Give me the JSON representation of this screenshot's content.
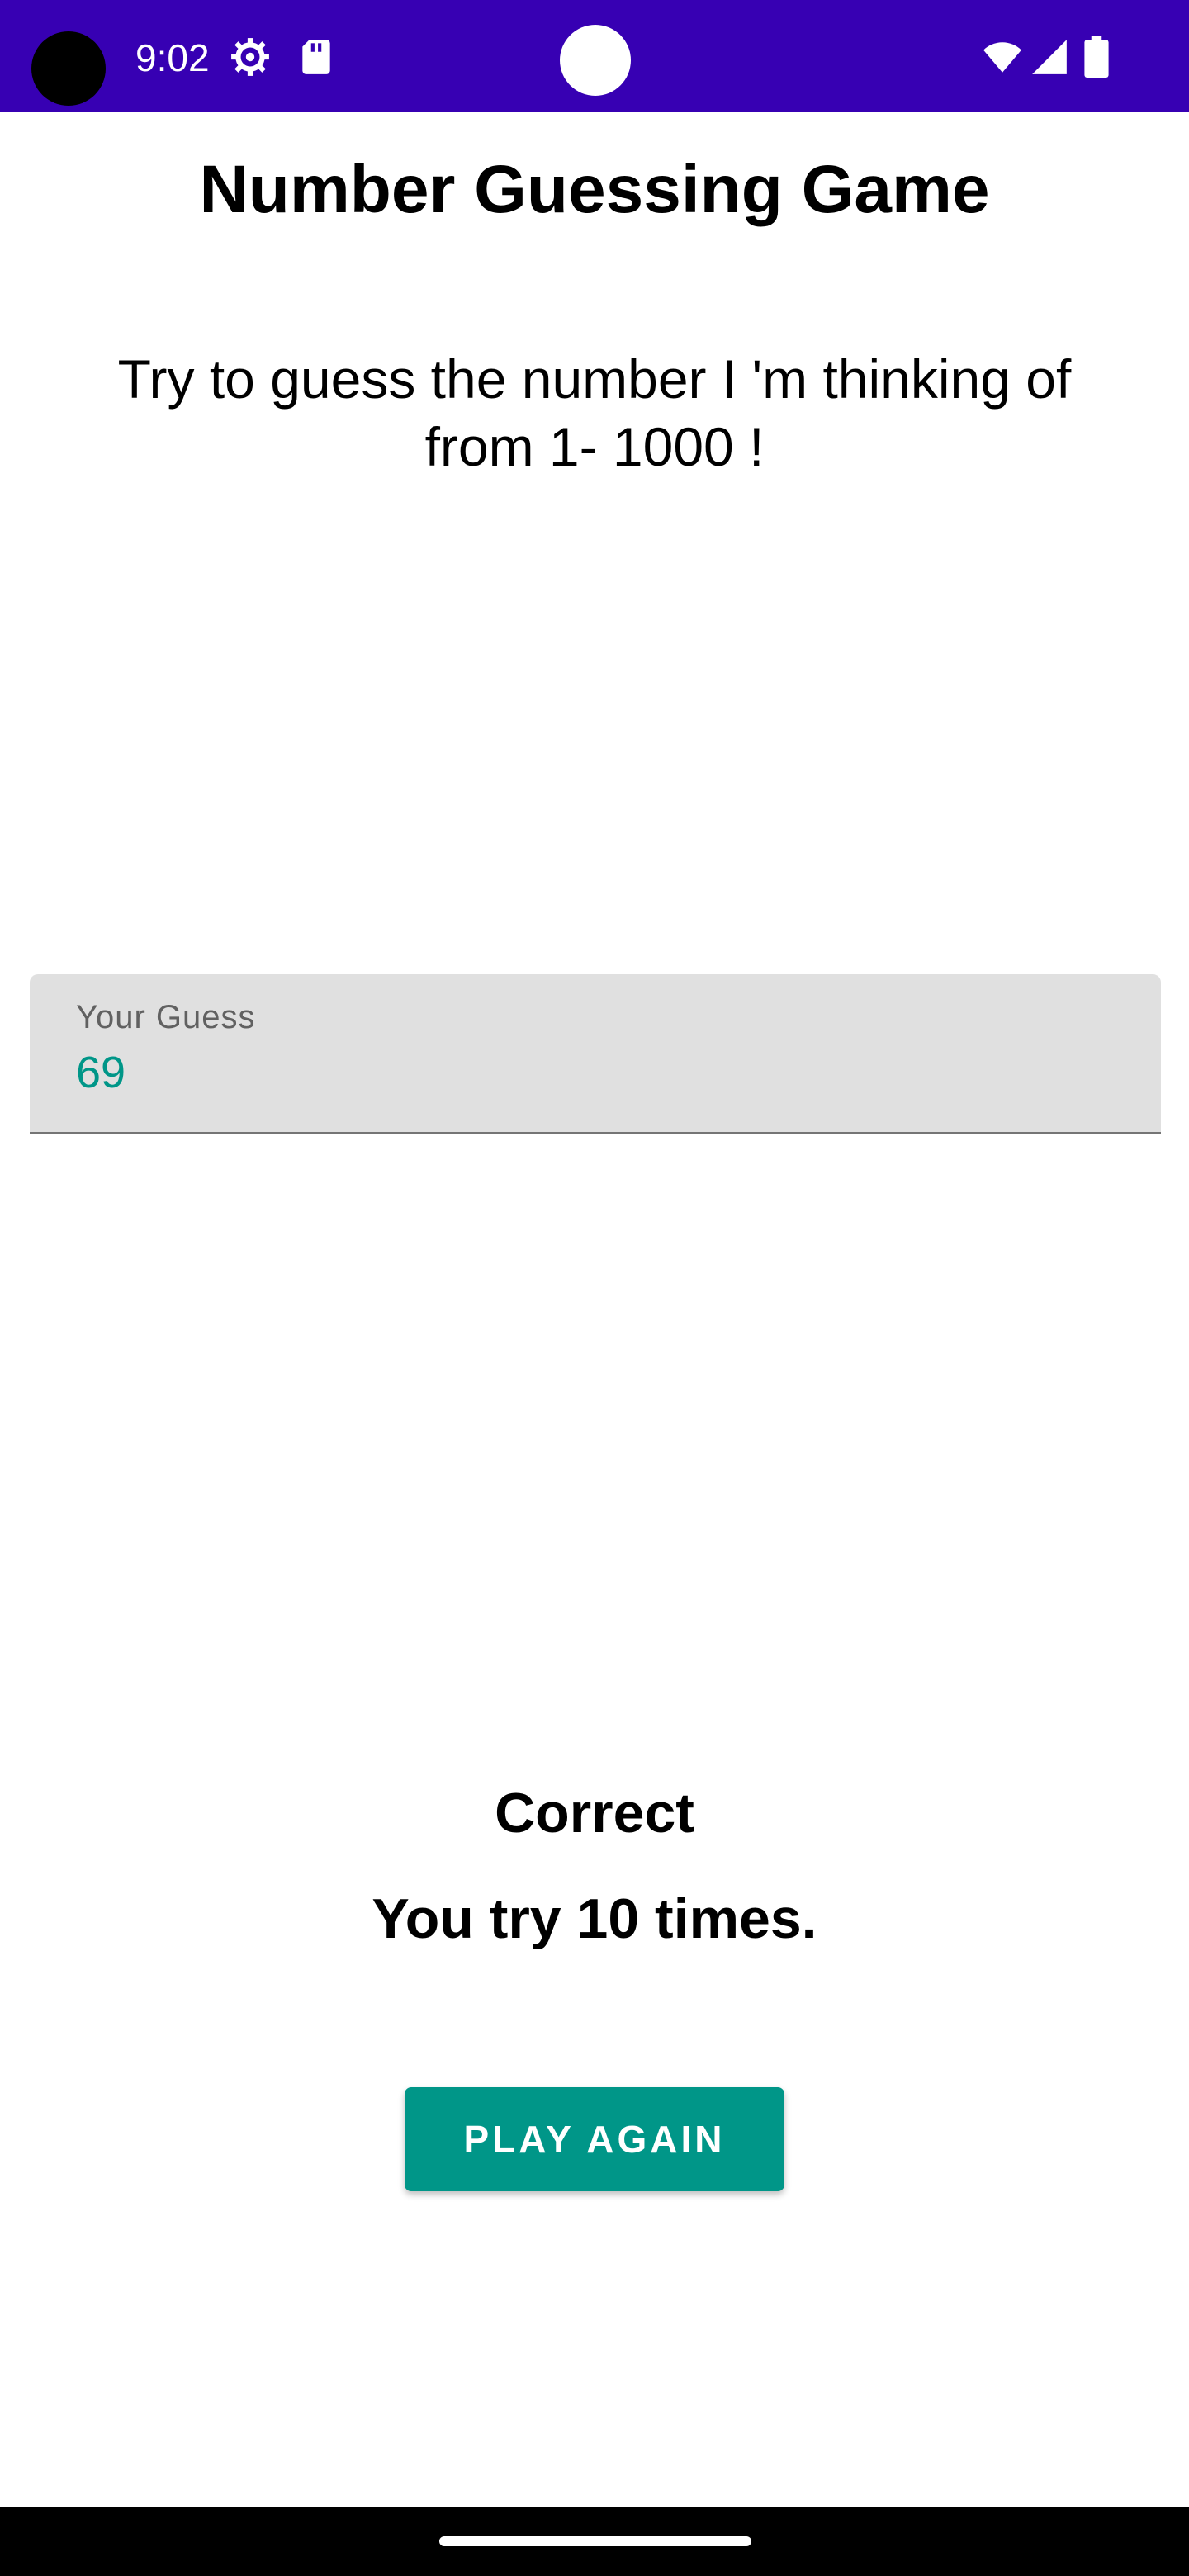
{
  "status_bar": {
    "time": "9:02",
    "color": "#3700b3",
    "icons": [
      "settings-icon",
      "sd-card-icon",
      "wifi-icon",
      "signal-icon",
      "battery-icon"
    ]
  },
  "app": {
    "title": "Number Guessing Game",
    "instructions": "Try to guess the number I 'm thinking of from 1- 1000 !"
  },
  "guess_input": {
    "label": "Your Guess",
    "value": "69"
  },
  "result": {
    "status": "Correct",
    "tries_message": "You try 10 times."
  },
  "actions": {
    "play_again_label": "PLAY AGAIN"
  },
  "colors": {
    "accent": "#009688",
    "status_bar": "#3700b3",
    "input_background": "#e0e0e0"
  }
}
